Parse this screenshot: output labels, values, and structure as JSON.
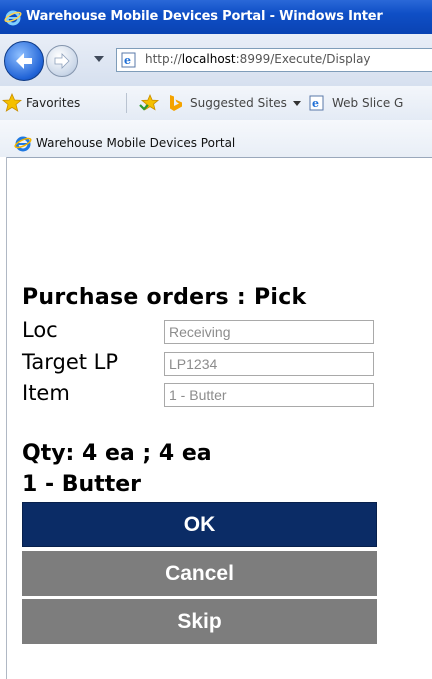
{
  "window": {
    "title": "Warehouse Mobile Devices Portal - Windows Inter"
  },
  "address_bar": {
    "url_prefix": "http://",
    "url_host": "localhost",
    "url_rest": ":8999/Execute/Display"
  },
  "favorites_bar": {
    "favorites_label": "Favorites",
    "suggested_sites_label": "Suggested Sites",
    "web_slice_label": "Web Slice G"
  },
  "tab": {
    "label": "Warehouse Mobile Devices Portal"
  },
  "form": {
    "heading": "Purchase orders : Pick",
    "fields": [
      {
        "label": "Loc",
        "value": "Receiving"
      },
      {
        "label": "Target LP",
        "value": "LP1234"
      },
      {
        "label": "Item",
        "value": "1 - Butter"
      }
    ],
    "qty_text": "Qty: 4 ea ; 4 ea",
    "item_text": "1 - Butter"
  },
  "buttons": {
    "ok": "OK",
    "cancel": "Cancel",
    "skip": "Skip"
  },
  "colors": {
    "ok_button": "#0b2c66",
    "secondary_button": "#7d7d7d",
    "title_bar": "#0f4fc6"
  }
}
